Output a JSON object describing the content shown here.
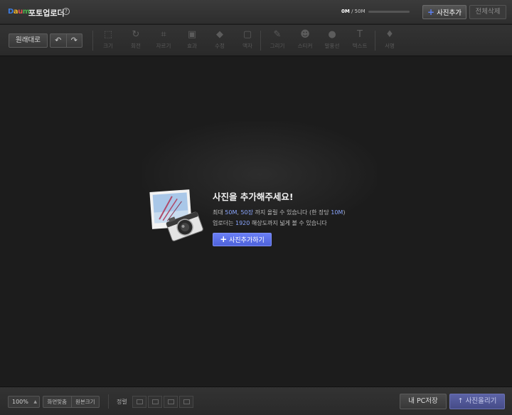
{
  "header": {
    "logo": {
      "d": "D",
      "a": "a",
      "u": "u",
      "m": "m"
    },
    "title": "포토업로더",
    "help_symbol": "?",
    "usage_used": "0M",
    "usage_total": "/ 50M",
    "usage_fraction": 0,
    "add_photo_label": "사진추가",
    "delete_all_label": "전체삭제"
  },
  "toolbar": {
    "original_label": "원래대로",
    "undo_symbol": "↶",
    "redo_symbol": "↷",
    "tools": [
      {
        "label": "크기",
        "icon": "resize-icon",
        "glyph": "⬚"
      },
      {
        "label": "회전",
        "icon": "rotate-icon",
        "glyph": "↻"
      },
      {
        "label": "자르기",
        "icon": "crop-icon",
        "glyph": "⌗"
      },
      {
        "label": "효과",
        "icon": "effect-icon",
        "glyph": "▣"
      },
      {
        "label": "수정",
        "icon": "eraser-icon",
        "glyph": "◆"
      },
      {
        "label": "액자",
        "icon": "frame-icon",
        "glyph": "▢"
      },
      {
        "label": "그리기",
        "icon": "brush-icon",
        "glyph": "✎"
      },
      {
        "label": "스티커",
        "icon": "sticker-icon",
        "glyph": "☻"
      },
      {
        "label": "말풍선",
        "icon": "speech-bubble-icon",
        "glyph": "●"
      },
      {
        "label": "텍스트",
        "icon": "text-icon",
        "glyph": "T"
      },
      {
        "label": "서명",
        "icon": "signature-icon",
        "glyph": "♦"
      }
    ]
  },
  "prompt": {
    "title": "사진을 추가해주세요!",
    "line1": {
      "a": "최대 ",
      "b": "50M",
      "c": ", ",
      "d": "50장",
      "e": " 까지 올릴 수 있습니다  (한 장당 ",
      "f": "10M",
      "g": ")"
    },
    "line2": {
      "a": "업로더는 ",
      "b": "1920",
      "c": " 해상도까지 넓게 볼 수 있습니다"
    },
    "button_label": "사진추가하기"
  },
  "bottom": {
    "zoom": "100%",
    "fit_screen_label": "화면맞춤",
    "original_size_label": "원본크기",
    "sort_label": "정렬",
    "save_pc_label": "내 PC저장",
    "upload_label": "사진올리기",
    "upload_symbol": "↑"
  },
  "colors": {
    "accent": "#5b6ff0",
    "upload": "#4f56a0",
    "background": "#1c1c1c"
  }
}
